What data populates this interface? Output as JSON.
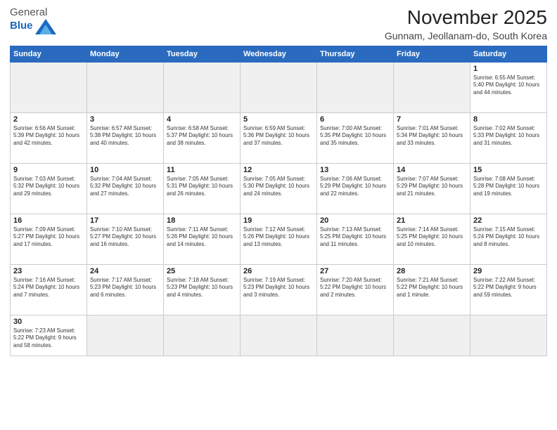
{
  "logo": {
    "text_general": "General",
    "text_blue": "Blue"
  },
  "header": {
    "title": "November 2025",
    "subtitle": "Gunnam, Jeollanam-do, South Korea"
  },
  "weekdays": [
    "Sunday",
    "Monday",
    "Tuesday",
    "Wednesday",
    "Thursday",
    "Friday",
    "Saturday"
  ],
  "weeks": [
    [
      {
        "day": "",
        "info": ""
      },
      {
        "day": "",
        "info": ""
      },
      {
        "day": "",
        "info": ""
      },
      {
        "day": "",
        "info": ""
      },
      {
        "day": "",
        "info": ""
      },
      {
        "day": "",
        "info": ""
      },
      {
        "day": "1",
        "info": "Sunrise: 6:55 AM\nSunset: 5:40 PM\nDaylight: 10 hours\nand 44 minutes."
      }
    ],
    [
      {
        "day": "2",
        "info": "Sunrise: 6:56 AM\nSunset: 5:39 PM\nDaylight: 10 hours\nand 42 minutes."
      },
      {
        "day": "3",
        "info": "Sunrise: 6:57 AM\nSunset: 5:38 PM\nDaylight: 10 hours\nand 40 minutes."
      },
      {
        "day": "4",
        "info": "Sunrise: 6:58 AM\nSunset: 5:37 PM\nDaylight: 10 hours\nand 38 minutes."
      },
      {
        "day": "5",
        "info": "Sunrise: 6:59 AM\nSunset: 5:36 PM\nDaylight: 10 hours\nand 37 minutes."
      },
      {
        "day": "6",
        "info": "Sunrise: 7:00 AM\nSunset: 5:35 PM\nDaylight: 10 hours\nand 35 minutes."
      },
      {
        "day": "7",
        "info": "Sunrise: 7:01 AM\nSunset: 5:34 PM\nDaylight: 10 hours\nand 33 minutes."
      },
      {
        "day": "8",
        "info": "Sunrise: 7:02 AM\nSunset: 5:33 PM\nDaylight: 10 hours\nand 31 minutes."
      }
    ],
    [
      {
        "day": "9",
        "info": "Sunrise: 7:03 AM\nSunset: 5:32 PM\nDaylight: 10 hours\nand 29 minutes."
      },
      {
        "day": "10",
        "info": "Sunrise: 7:04 AM\nSunset: 5:32 PM\nDaylight: 10 hours\nand 27 minutes."
      },
      {
        "day": "11",
        "info": "Sunrise: 7:05 AM\nSunset: 5:31 PM\nDaylight: 10 hours\nand 26 minutes."
      },
      {
        "day": "12",
        "info": "Sunrise: 7:05 AM\nSunset: 5:30 PM\nDaylight: 10 hours\nand 24 minutes."
      },
      {
        "day": "13",
        "info": "Sunrise: 7:06 AM\nSunset: 5:29 PM\nDaylight: 10 hours\nand 22 minutes."
      },
      {
        "day": "14",
        "info": "Sunrise: 7:07 AM\nSunset: 5:29 PM\nDaylight: 10 hours\nand 21 minutes."
      },
      {
        "day": "15",
        "info": "Sunrise: 7:08 AM\nSunset: 5:28 PM\nDaylight: 10 hours\nand 19 minutes."
      }
    ],
    [
      {
        "day": "16",
        "info": "Sunrise: 7:09 AM\nSunset: 5:27 PM\nDaylight: 10 hours\nand 17 minutes."
      },
      {
        "day": "17",
        "info": "Sunrise: 7:10 AM\nSunset: 5:27 PM\nDaylight: 10 hours\nand 16 minutes."
      },
      {
        "day": "18",
        "info": "Sunrise: 7:11 AM\nSunset: 5:26 PM\nDaylight: 10 hours\nand 14 minutes."
      },
      {
        "day": "19",
        "info": "Sunrise: 7:12 AM\nSunset: 5:26 PM\nDaylight: 10 hours\nand 13 minutes."
      },
      {
        "day": "20",
        "info": "Sunrise: 7:13 AM\nSunset: 5:25 PM\nDaylight: 10 hours\nand 11 minutes."
      },
      {
        "day": "21",
        "info": "Sunrise: 7:14 AM\nSunset: 5:25 PM\nDaylight: 10 hours\nand 10 minutes."
      },
      {
        "day": "22",
        "info": "Sunrise: 7:15 AM\nSunset: 5:24 PM\nDaylight: 10 hours\nand 8 minutes."
      }
    ],
    [
      {
        "day": "23",
        "info": "Sunrise: 7:16 AM\nSunset: 5:24 PM\nDaylight: 10 hours\nand 7 minutes."
      },
      {
        "day": "24",
        "info": "Sunrise: 7:17 AM\nSunset: 5:23 PM\nDaylight: 10 hours\nand 6 minutes."
      },
      {
        "day": "25",
        "info": "Sunrise: 7:18 AM\nSunset: 5:23 PM\nDaylight: 10 hours\nand 4 minutes."
      },
      {
        "day": "26",
        "info": "Sunrise: 7:19 AM\nSunset: 5:23 PM\nDaylight: 10 hours\nand 3 minutes."
      },
      {
        "day": "27",
        "info": "Sunrise: 7:20 AM\nSunset: 5:22 PM\nDaylight: 10 hours\nand 2 minutes."
      },
      {
        "day": "28",
        "info": "Sunrise: 7:21 AM\nSunset: 5:22 PM\nDaylight: 10 hours\nand 1 minute."
      },
      {
        "day": "29",
        "info": "Sunrise: 7:22 AM\nSunset: 5:22 PM\nDaylight: 9 hours\nand 59 minutes."
      }
    ],
    [
      {
        "day": "30",
        "info": "Sunrise: 7:23 AM\nSunset: 5:22 PM\nDaylight: 9 hours\nand 58 minutes."
      },
      {
        "day": "",
        "info": ""
      },
      {
        "day": "",
        "info": ""
      },
      {
        "day": "",
        "info": ""
      },
      {
        "day": "",
        "info": ""
      },
      {
        "day": "",
        "info": ""
      },
      {
        "day": "",
        "info": ""
      }
    ]
  ]
}
